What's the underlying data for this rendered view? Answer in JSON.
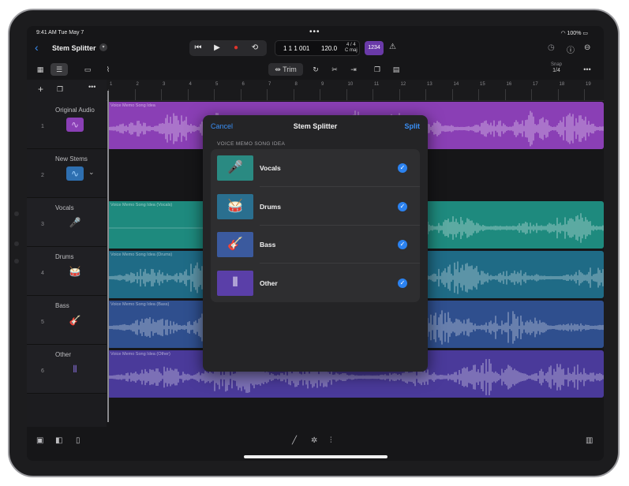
{
  "status": {
    "time": "9:41 AM  Tue May 7",
    "battery": "100%"
  },
  "header": {
    "title": "Stem Splitter",
    "lcd_position": "1 1 1 001",
    "lcd_tempo": "120.0",
    "lcd_signature": "4 / 4",
    "lcd_key": "C maj",
    "count_in": "1234"
  },
  "toolbar": {
    "trim_label": "Trim",
    "snap_label": "Snap",
    "snap_value": "1/4"
  },
  "ruler": [
    "1",
    "2",
    "3",
    "4",
    "5",
    "6",
    "7",
    "8",
    "9",
    "10",
    "11",
    "12",
    "13",
    "14",
    "15",
    "16",
    "17",
    "18",
    "19"
  ],
  "tracks": [
    {
      "number": "1",
      "name": "Original Audio"
    },
    {
      "number": "2",
      "name": "New Stems"
    },
    {
      "number": "3",
      "name": "Vocals"
    },
    {
      "number": "4",
      "name": "Drums"
    },
    {
      "number": "5",
      "name": "Bass"
    },
    {
      "number": "6",
      "name": "Other"
    }
  ],
  "regions": [
    {
      "label": "Voice Memo Song Idea",
      "color": "#8a3fb5"
    },
    {
      "label": "Voice Memo Song Idea (Vocals)",
      "color": "#1e8a7e"
    },
    {
      "label": "Voice Memo Song Idea (Drums)",
      "color": "#1f6b86"
    },
    {
      "label": "Voice Memo Song Idea (Bass)",
      "color": "#2f4f8e"
    },
    {
      "label": "Voice Memo Song Idea (Other)",
      "color": "#4a3a9a"
    }
  ],
  "dialog": {
    "cancel": "Cancel",
    "title": "Stem Splitter",
    "split": "Split",
    "section": "VOICE MEMO SONG IDEA",
    "items": [
      {
        "label": "Vocals",
        "checked": true,
        "color": "#2a8a82"
      },
      {
        "label": "Drums",
        "checked": true,
        "color": "#2a6f8f"
      },
      {
        "label": "Bass",
        "checked": true,
        "color": "#3b5a9e"
      },
      {
        "label": "Other",
        "checked": true,
        "color": "#5a3fa8"
      }
    ]
  }
}
